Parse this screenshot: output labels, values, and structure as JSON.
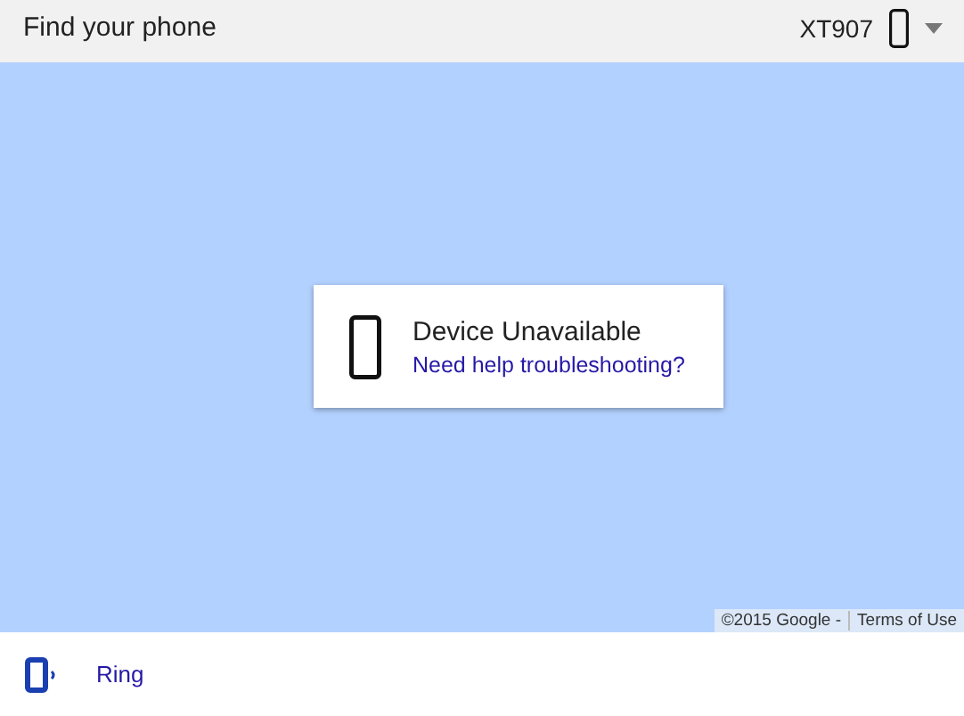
{
  "header": {
    "title": "Find your phone",
    "device": "XT907"
  },
  "card": {
    "status": "Device Unavailable",
    "link": "Need help troubleshooting?"
  },
  "attribution": [
    "©2015 Google -",
    "Terms of Use"
  ],
  "actions": [
    {
      "label": "Ring"
    }
  ]
}
